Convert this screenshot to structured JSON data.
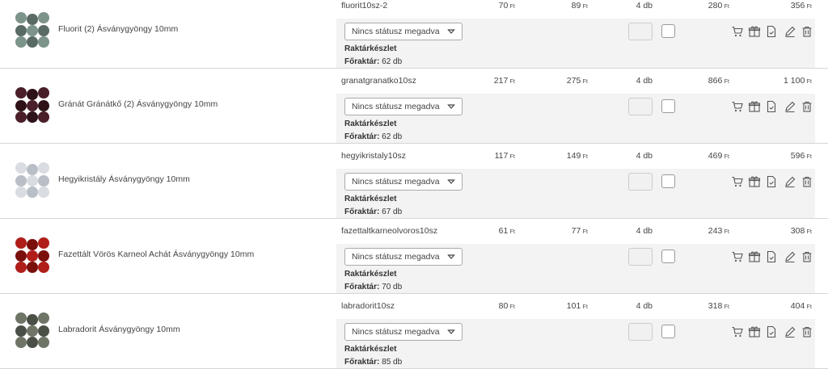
{
  "currency": "Ft",
  "status_placeholder": "Nincs státusz megadva",
  "stock_title": "Raktárkészlet",
  "warehouse_label": "Főraktár:",
  "products": [
    {
      "name": "Fluorit (2) Ásványgyöngy 10mm",
      "sku": "fluorit10sz-2",
      "net_price": "70",
      "gross_price": "89",
      "quantity": "4 db",
      "sum_net": "280",
      "sum_gross": "356",
      "stock": "62 db",
      "thumb_color": "#7d948a",
      "thumb_accent": "#5a6b66"
    },
    {
      "name": "Gránát Gránátkő (2) Ásványgyöngy 10mm",
      "sku": "granatgranatko10sz",
      "net_price": "217",
      "gross_price": "275",
      "quantity": "4 db",
      "sum_net": "866",
      "sum_gross": "1 100",
      "stock": "62 db",
      "thumb_color": "#4a1f2a",
      "thumb_accent": "#2e1218"
    },
    {
      "name": "Hegyikristály Ásványgyöngy 10mm",
      "sku": "hegyikristaly10sz",
      "net_price": "117",
      "gross_price": "149",
      "quantity": "4 db",
      "sum_net": "469",
      "sum_gross": "596",
      "stock": "67 db",
      "thumb_color": "#d9dde2",
      "thumb_accent": "#b9bfc7"
    },
    {
      "name": "Fazettált Vörös Karneol Achát Ásványgyöngy 10mm",
      "sku": "fazettaltkarneolvoros10sz",
      "net_price": "61",
      "gross_price": "77",
      "quantity": "4 db",
      "sum_net": "243",
      "sum_gross": "308",
      "stock": "70 db",
      "thumb_color": "#b01e1a",
      "thumb_accent": "#7a0f0c"
    },
    {
      "name": "Labradorit Ásványgyöngy 10mm",
      "sku": "labradorit10sz",
      "net_price": "80",
      "gross_price": "101",
      "quantity": "4 db",
      "sum_net": "318",
      "sum_gross": "404",
      "stock": "85 db",
      "thumb_color": "#6f7566",
      "thumb_accent": "#4b5046"
    }
  ]
}
